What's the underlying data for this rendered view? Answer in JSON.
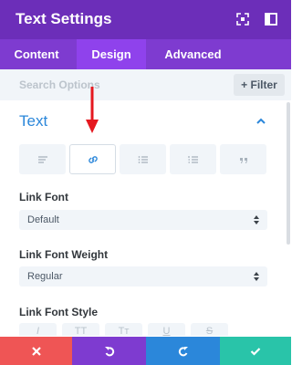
{
  "header": {
    "title": "Text Settings",
    "icons": [
      "expand-icon",
      "split-view-icon"
    ],
    "color": "#6c2eb9"
  },
  "tabs": [
    {
      "label": "Content",
      "active": false
    },
    {
      "label": "Design",
      "active": true
    },
    {
      "label": "Advanced",
      "active": false
    }
  ],
  "search": {
    "placeholder": "Search Options",
    "filter_label": "+ Filter"
  },
  "section": {
    "title": "Text",
    "title_color": "#2b87da",
    "icons": [
      "paragraph-text-icon",
      "link-icon",
      "unordered-list-icon",
      "ordered-list-icon",
      "quote-icon"
    ],
    "active_icon": "link-icon"
  },
  "annotation": {
    "icon": "red-down-arrow-icon",
    "color": "#e5181f"
  },
  "fields": {
    "link_font": {
      "label": "Link Font",
      "value": "Default"
    },
    "link_font_weight": {
      "label": "Link Font Weight",
      "value": "Regular"
    },
    "link_font_style": {
      "label": "Link Font Style",
      "options": [
        "I",
        "TT",
        "Tт",
        "U",
        "S"
      ]
    }
  },
  "footer": {
    "buttons": [
      {
        "name": "cancel-button",
        "icon": "close-icon",
        "color": "#ef5555"
      },
      {
        "name": "undo-button",
        "icon": "undo-icon",
        "color": "#7e3bd0"
      },
      {
        "name": "redo-button",
        "icon": "redo-icon",
        "color": "#2b87da"
      },
      {
        "name": "save-button",
        "icon": "check-icon",
        "color": "#29c4a9"
      }
    ]
  }
}
